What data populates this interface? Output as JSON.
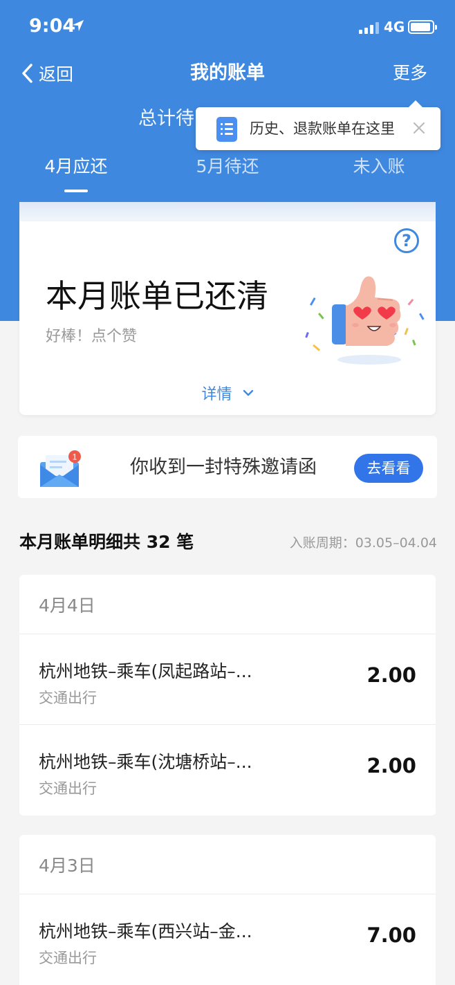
{
  "status_bar": {
    "time": "9:04",
    "network": "4G"
  },
  "nav": {
    "back_label": "返回",
    "title": "我的账单",
    "more_label": "更多"
  },
  "total_label": "总计待",
  "tooltip": {
    "text": "历史、退款账单在这里"
  },
  "tabs": [
    {
      "label": "4月应还",
      "active": true
    },
    {
      "label": "5月待还",
      "active": false
    },
    {
      "label": "未入账",
      "active": false
    }
  ],
  "paid_card": {
    "help_symbol": "?",
    "title": "本月账单已还清",
    "subtitle": "好棒！点个赞",
    "detail_label": "详情"
  },
  "invite": {
    "badge": "1",
    "text": "你收到一封特殊邀请函",
    "button": "去看看"
  },
  "section": {
    "title": "本月账单明细共 32 笔",
    "period": "入账周期：03.05–04.04"
  },
  "groups": [
    {
      "date": "4月4日",
      "items": [
        {
          "name": "杭州地铁–乘车(凤起路站–...",
          "category": "交通出行",
          "amount": "2.00"
        },
        {
          "name": "杭州地铁–乘车(沈塘桥站–...",
          "category": "交通出行",
          "amount": "2.00"
        }
      ]
    },
    {
      "date": "4月3日",
      "items": [
        {
          "name": "杭州地铁–乘车(西兴站–金...",
          "category": "交通出行",
          "amount": "7.00"
        }
      ]
    }
  ],
  "colors": {
    "primary": "#3f88e0",
    "button": "#3275e8",
    "badge": "#f05a4a"
  }
}
